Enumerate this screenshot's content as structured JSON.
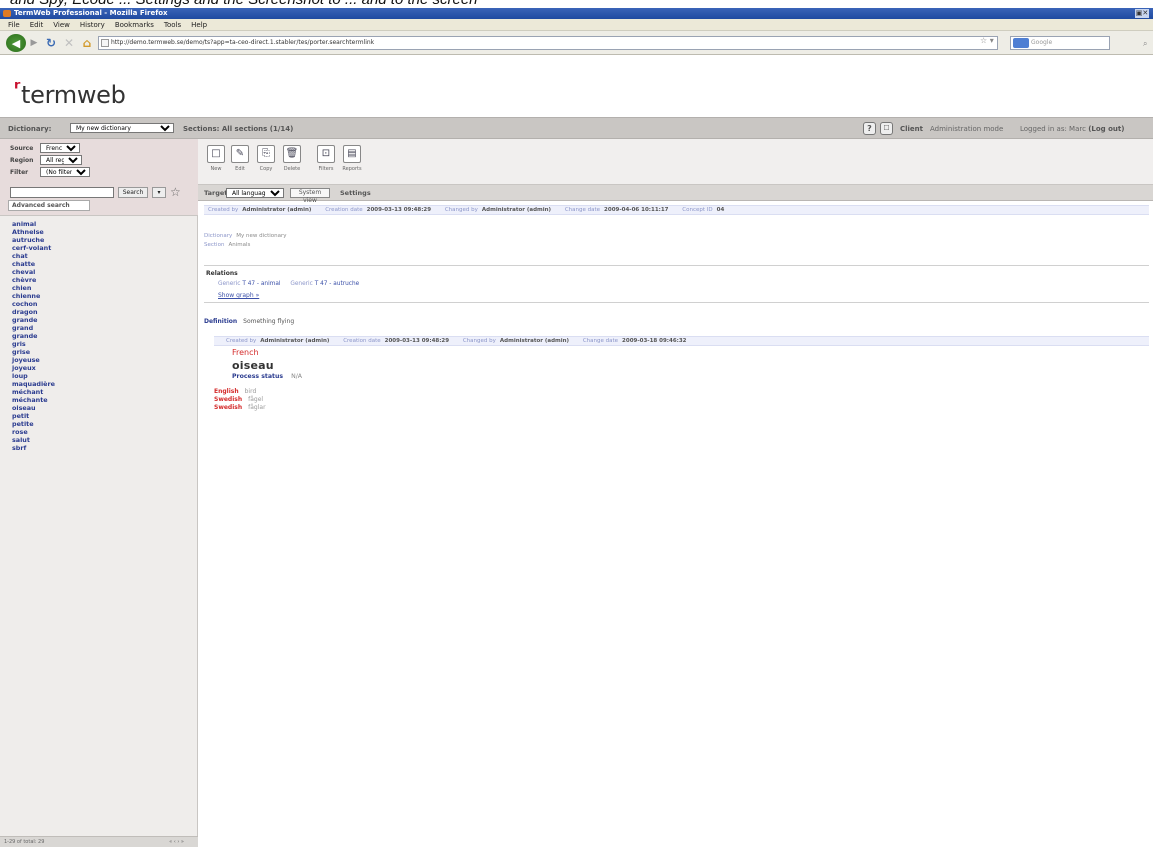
{
  "caption": "and Spy, Ecode ... Settings and the Screenshot to ... and to the screen",
  "window": {
    "title": "TermWeb Professional - Mozilla Firefox"
  },
  "menu": [
    "File",
    "Edit",
    "View",
    "History",
    "Bookmarks",
    "Tools",
    "Help"
  ],
  "browser": {
    "url": "http://demo.termweb.se/demo/ts?app=ta-ceo-direct.1.stabler/tes/porter.searchtermlink",
    "search_placeholder": "Google"
  },
  "logo": "termweb",
  "dictbar": {
    "dictionary_label": "Dictionary:",
    "dictionary_value": "My new dictionary",
    "sections_label": "Sections:",
    "sections_value": "All sections (1/14)",
    "client_label": "Client",
    "mode": "Administration mode",
    "logged_in": "Logged in as: Marc",
    "logout": "(Log out)"
  },
  "filters": {
    "source_label": "Source",
    "source_value": "French",
    "region_label": "Region",
    "region_value": "All regions",
    "filter_label": "Filter",
    "filter_value": "(No filter)",
    "search_button": "Search",
    "advanced_search": "Advanced search"
  },
  "terms": [
    "animal",
    "Athnelse",
    "autruche",
    "cerf-volant",
    "chat",
    "chatte",
    "cheval",
    "chèvre",
    "chien",
    "chienne",
    "cochon",
    "dragon",
    "grande",
    "grand",
    "grande",
    "gris",
    "grise",
    "joyeuse",
    "joyeux",
    "loup",
    "maquadière",
    "méchant",
    "méchante",
    "oiseau",
    "petit",
    "petite",
    "rose",
    "salut",
    "sbrf"
  ],
  "sidebar_footer": {
    "left": "1-29 of total: 29",
    "right": "« ‹ › »"
  },
  "toolbar": {
    "new": "New",
    "edit": "Edit",
    "copy": "Copy",
    "delete": "Delete",
    "filters": "Filters",
    "reports": "Reports"
  },
  "target": {
    "label": "Target:",
    "value": "All languages",
    "system_view": "System view",
    "settings": "Settings"
  },
  "entry": {
    "meta": [
      {
        "k": "Created by",
        "v": "Administrator (admin)"
      },
      {
        "k": "Creation date",
        "v": "2009-03-13 09:48:29"
      },
      {
        "k": "Changed by",
        "v": "Administrator (admin)"
      },
      {
        "k": "Change date",
        "v": "2009-04-06 10:11:17"
      },
      {
        "k": "Concept ID",
        "v": "04"
      }
    ],
    "fields": [
      {
        "k": "Dictionary",
        "v": "My new dictionary"
      },
      {
        "k": "Section",
        "v": "Animals"
      }
    ],
    "relations_title": "Relations",
    "relations": [
      {
        "k": "Generic",
        "v": "T 47 - animal"
      },
      {
        "k": "Generic",
        "v": "T 47 - autruche"
      }
    ],
    "show_graph": "Show graph »",
    "definition_label": "Definition",
    "definition_value": "Something flying"
  },
  "term": {
    "meta": [
      {
        "k": "Created by",
        "v": "Administrator (admin)"
      },
      {
        "k": "Creation date",
        "v": "2009-03-13 09:48:29"
      },
      {
        "k": "Changed by",
        "v": "Administrator (admin)"
      },
      {
        "k": "Change date",
        "v": "2009-03-18 09:46:32"
      }
    ],
    "language": "French",
    "value": "oiseau",
    "process_label": "Process status",
    "process_value": "N/A"
  },
  "translations": [
    {
      "lang": "English",
      "value": "bird"
    },
    {
      "lang": "Swedish",
      "value": "fågel"
    },
    {
      "lang": "Swedish",
      "value": "fåglar"
    }
  ],
  "colors": {
    "accent_red": "#d42b2b",
    "link_blue": "#2a3b8f",
    "dict_bar": "#c9c6c3",
    "filter_pink": "#e7dcdc",
    "meta_row": "#eef0fb"
  }
}
